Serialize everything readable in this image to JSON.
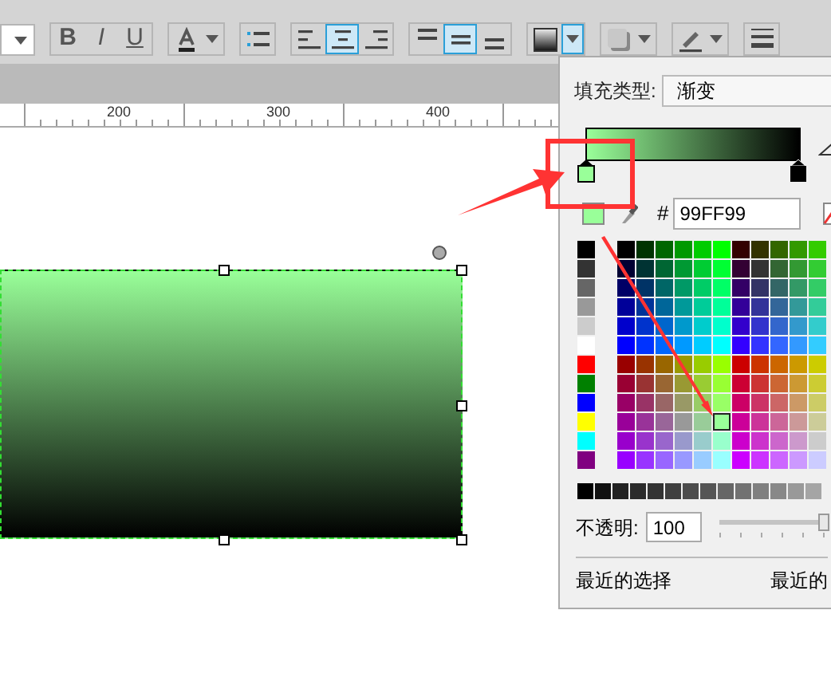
{
  "toolbar": {
    "groups": [
      {
        "items": [
          {
            "kind": "bold",
            "label": "B",
            "selected": false
          },
          {
            "kind": "italic",
            "label": "I",
            "selected": false
          },
          {
            "kind": "underline",
            "label": "U",
            "selected": false
          }
        ]
      },
      {
        "items": [
          {
            "kind": "font_color",
            "selected": false
          }
        ]
      },
      {
        "items": [
          {
            "kind": "bullets",
            "selected": false
          }
        ]
      },
      {
        "items": [
          {
            "kind": "align_left",
            "selected": false
          },
          {
            "kind": "align_center",
            "selected": true
          },
          {
            "kind": "align_right",
            "selected": false
          }
        ]
      },
      {
        "items": [
          {
            "kind": "valign_top",
            "selected": false
          },
          {
            "kind": "valign_middle",
            "selected": true
          },
          {
            "kind": "valign_bottom",
            "selected": false
          }
        ]
      },
      {
        "items": [
          {
            "kind": "fill",
            "selected": false
          },
          {
            "kind": "dropdown",
            "selected": true
          }
        ]
      },
      {
        "items": [
          {
            "kind": "shadow",
            "selected": false
          }
        ]
      },
      {
        "items": [
          {
            "kind": "line_color",
            "selected": false
          }
        ]
      },
      {
        "items": [
          {
            "kind": "line_weight",
            "selected": false
          }
        ]
      }
    ]
  },
  "ruler": {
    "labels": [
      "200",
      "300",
      "400"
    ]
  },
  "fill_panel": {
    "fill_type_label": "填充类型:",
    "fill_type": "渐变",
    "color": "#99ff99",
    "hex_prefix": "#",
    "hex_value": "99FF99",
    "opacity_label": "不透明:",
    "opacity_value": "100",
    "opacity_slider": {
      "level": 1
    },
    "recent_label": "最近的选择",
    "recent_label_2": "最近的"
  }
}
